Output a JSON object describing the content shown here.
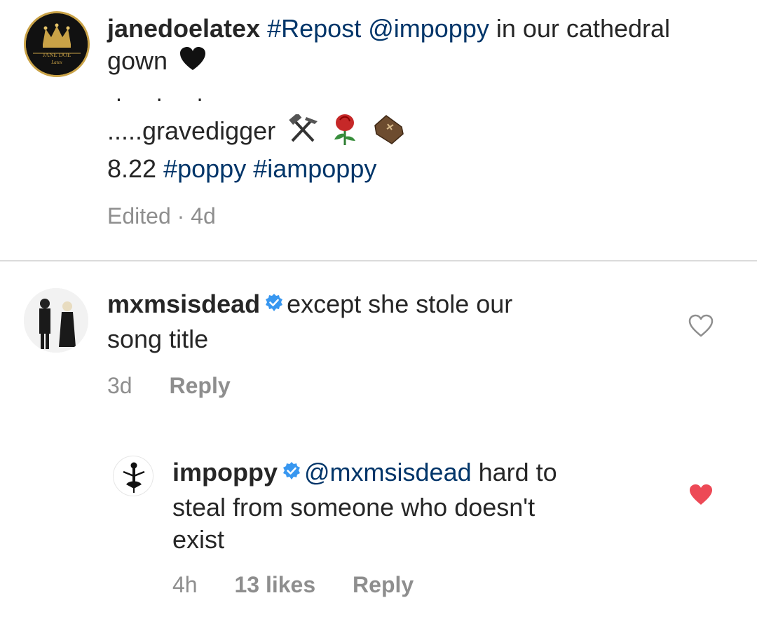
{
  "post": {
    "username": "janedoelatex",
    "caption_parts": {
      "repost_tag": "#Repost",
      "mention": "@impoppy",
      "text1": "in our cathedral gown",
      "dots": ". . .",
      "line3": ".....gravedigger",
      "date": "8.22",
      "tag1": "#poppy",
      "tag2": "#iampoppy"
    },
    "avatar_text": {
      "line1": "JANE DOE",
      "line2": "Latex"
    },
    "meta": "Edited · 4d",
    "icons": [
      "black-heart-icon",
      "hammer-pick-icon",
      "rose-icon",
      "coffin-icon"
    ]
  },
  "comments": [
    {
      "username": "mxmsisdead",
      "verified": true,
      "text_line1": "except she stole our",
      "text_line2": "song title",
      "time": "3d",
      "reply_label": "Reply",
      "liked": false
    },
    {
      "username": "impoppy",
      "verified": true,
      "mention": "@mxmsisdead",
      "text_line1": "hard to",
      "text_line2": "steal from someone who doesn't",
      "text_line3": "exist",
      "time": "4h",
      "likes": "13 likes",
      "reply_label": "Reply",
      "liked": true
    }
  ],
  "colors": {
    "link": "#003569",
    "meta": "#8e8e8e",
    "verified": "#3897f0",
    "like": "#ed4956",
    "divider": "#dbdbdb"
  }
}
